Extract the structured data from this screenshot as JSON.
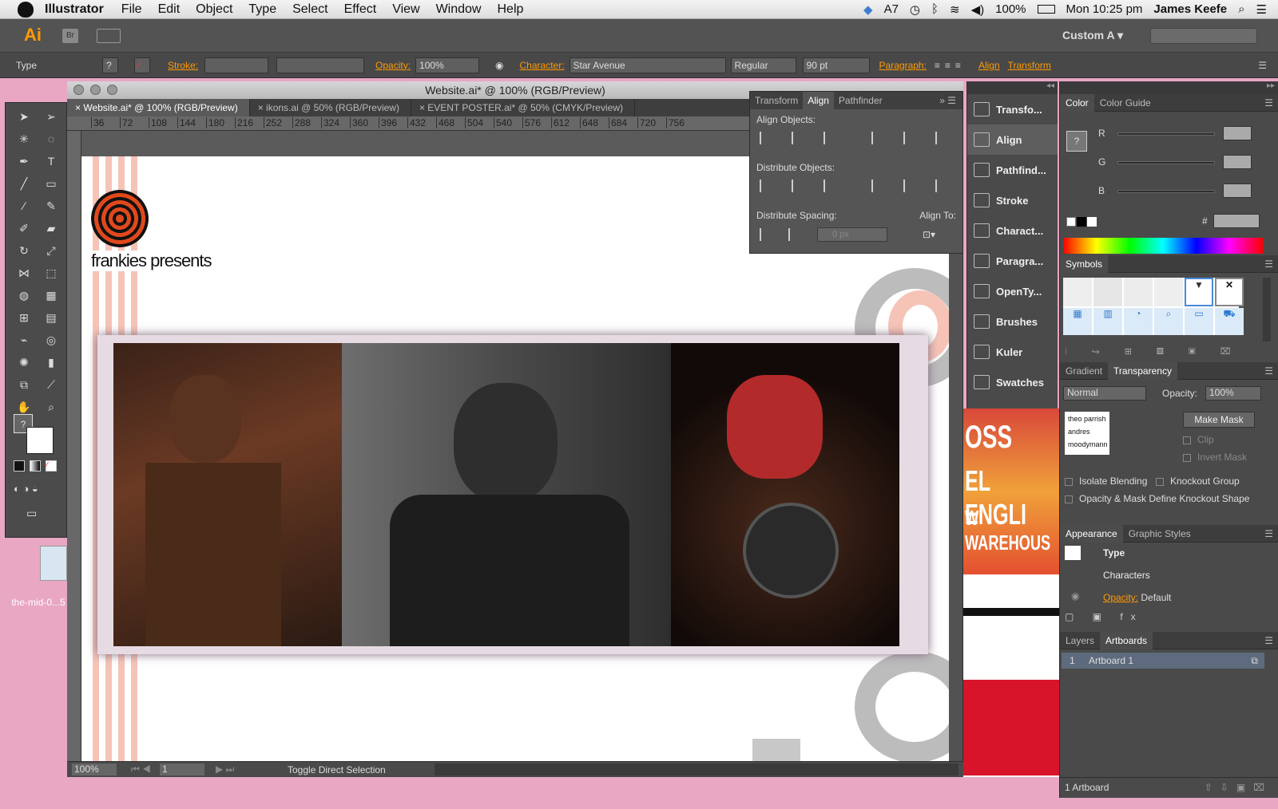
{
  "menubar": {
    "app": "Illustrator",
    "items": [
      "File",
      "Edit",
      "Object",
      "Type",
      "Select",
      "Effect",
      "View",
      "Window",
      "Help"
    ],
    "status": {
      "notif": "7",
      "battery": "100%",
      "clock": "Mon 10:25 pm",
      "user": "James Keefe"
    }
  },
  "appbar": {
    "logo": "Ai",
    "bridge": "Br",
    "workspace": "Custom A"
  },
  "controlbar": {
    "tool": "Type",
    "stroke_label": "Stroke:",
    "opacity_label": "Opacity:",
    "opacity_value": "100%",
    "character_label": "Character:",
    "font": "Star Avenue",
    "style": "Regular",
    "size": "90 pt",
    "paragraph_label": "Paragraph:",
    "align_link": "Align",
    "transform_link": "Transform"
  },
  "document": {
    "title": "Website.ai* @ 100% (RGB/Preview)",
    "tabs": [
      "Website.ai* @ 100% (RGB/Preview)",
      "ikons.ai @ 50% (RGB/Preview)",
      "EVENT POSTER.ai* @ 50% (CMYK/Preview)"
    ],
    "ruler": [
      "36",
      "72",
      "108",
      "144",
      "180",
      "216",
      "252",
      "288",
      "324",
      "360",
      "396",
      "432",
      "468",
      "504",
      "540",
      "576",
      "612",
      "648",
      "684",
      "720",
      "756"
    ],
    "logo_text": "frankies presents",
    "status": {
      "zoom": "100%",
      "page": "1",
      "info": "Toggle Direct Selection"
    }
  },
  "alignpanel": {
    "tabs": [
      "Transform",
      "Align",
      "Pathfinder"
    ],
    "align_objects": "Align Objects:",
    "distribute_objects": "Distribute Objects:",
    "distribute_spacing": "Distribute Spacing:",
    "align_to": "Align To:",
    "spacing_value": "0 px"
  },
  "dock": [
    "Transfo...",
    "Align",
    "Pathfind...",
    "Stroke",
    "Charact...",
    "Paragra...",
    "OpenTy...",
    "Brushes",
    "Kuler",
    "Swatches"
  ],
  "colorpanel": {
    "tabs": [
      "Color",
      "Color Guide"
    ],
    "channels": [
      "R",
      "G",
      "B"
    ],
    "hash": "#"
  },
  "symbols": {
    "title": "Symbols"
  },
  "transparency": {
    "tabs": [
      "Gradient",
      "Transparency"
    ],
    "mode": "Normal",
    "opacity_label": "Opacity:",
    "opacity_value": "100%",
    "make_mask": "Make Mask",
    "clip": "Clip",
    "invert": "Invert Mask",
    "isolate": "Isolate Blending",
    "knockout": "Knockout Group",
    "define": "Opacity & Mask Define Knockout Shape",
    "thumb_lines": [
      "theo parrish",
      "andres",
      "moodymann"
    ]
  },
  "appearance": {
    "tabs": [
      "Appearance",
      "Graphic Styles"
    ],
    "rows": [
      "Type",
      "Characters"
    ],
    "opacity_label": "Opacity:",
    "opacity_value": "Default"
  },
  "layers": {
    "tabs": [
      "Layers",
      "Artboards"
    ],
    "row_num": "1",
    "row_name": "Artboard 1",
    "footer": "1 Artboard"
  },
  "desktop": {
    "label": "the-mid-0...5"
  },
  "poster": {
    "lines": [
      "OSS",
      "EL ENGLI",
      "W WAREHOUS"
    ]
  }
}
